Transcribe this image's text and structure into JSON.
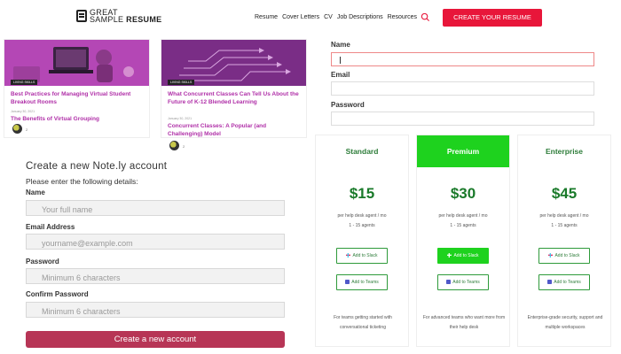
{
  "header": {
    "logo_line1": "GREAT",
    "logo_line2": "SAMPLE",
    "logo_line2_bold": "RESUME",
    "nav": [
      "Resume",
      "Cover Letters",
      "CV",
      "Job Descriptions",
      "Resources"
    ],
    "cta_label": "CREATE YOUR RESUME",
    "accent": "#e8163a"
  },
  "cards": [
    {
      "badge": "LIVING SKILLS",
      "title": "Best Practices for Managing Virtual Student Breakout Rooms",
      "date": "January 30, 2021",
      "subtitle": "The Benefits of Virtual Grouping",
      "author": "2"
    },
    {
      "badge": "LIVING SKILLS",
      "title": "What Concurrent Classes Can Tell Us About the Future of K-12 Blended Learning",
      "date": "January 30, 2021",
      "subtitle": "Concurrent Classes: A Popular (and Challenging) Model",
      "author": "2"
    }
  ],
  "top_form": {
    "name_label": "Name",
    "email_label": "Email",
    "password_label": "Password",
    "name_value": "",
    "email_value": "",
    "password_value": ""
  },
  "signup": {
    "title": "Create a new Note.ly account",
    "instructions": "Please enter the following details:",
    "name_label": "Name",
    "name_placeholder": "Your full name",
    "email_label": "Email Address",
    "email_placeholder": "yourname@example.com",
    "password_label": "Password",
    "password_placeholder": "Minimum 6 characters",
    "confirm_label": "Confirm Password",
    "confirm_placeholder": "Minimum 6 characters",
    "submit_label": "Create a new account",
    "submit_color": "#b73556"
  },
  "pricing": {
    "accent": "#1ed21e",
    "plans": [
      {
        "name": "Standard",
        "price": "$15",
        "unit": "per help desk agent / mo",
        "agents": "1 - 15 agents",
        "slack_label": "Add to Slack",
        "teams_label": "Add to Teams",
        "description": "For teams getting started with conversational ticketing"
      },
      {
        "name": "Premium",
        "price": "$30",
        "unit": "per help desk agent / mo",
        "agents": "1 - 15 agents",
        "slack_label": "Add to Slack",
        "teams_label": "Add to Teams",
        "description": "For advanced teams who want more from their help desk"
      },
      {
        "name": "Enterprise",
        "price": "$45",
        "unit": "per help desk agent / mo",
        "agents": "1 - 15 agents",
        "slack_label": "Add to Slack",
        "teams_label": "Add to Teams",
        "description": "Enterprise-grade security, support and multiple workspaces"
      }
    ]
  }
}
